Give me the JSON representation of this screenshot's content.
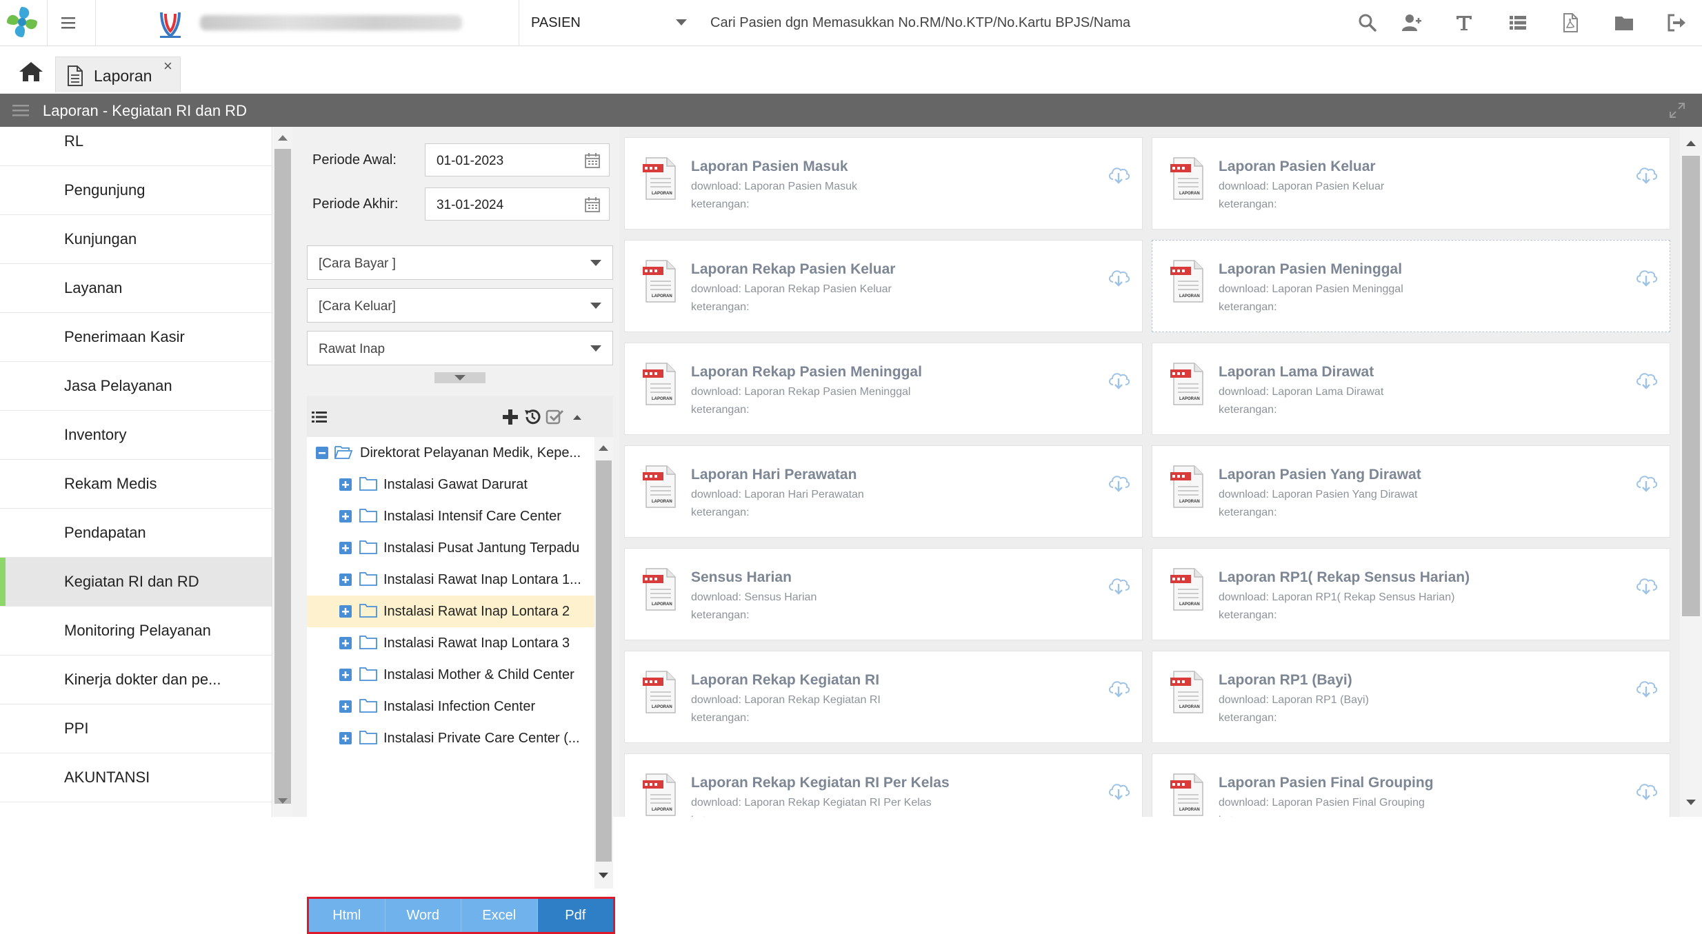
{
  "topbar": {
    "module_select": "PASIEN",
    "search_placeholder": "Cari Pasien dgn Memasukkan No.RM/No.KTP/No.Kartu BPJS/Nama",
    "icons": [
      "search-icon",
      "add-user-icon",
      "text-icon",
      "list-icon",
      "pdf-file-icon",
      "folder-icon",
      "logout-icon"
    ]
  },
  "tabs": [
    {
      "label": "Laporan",
      "close": "×"
    }
  ],
  "titlebar": {
    "title": "Laporan - Kegiatan RI dan RD"
  },
  "sidebar": {
    "items": [
      {
        "label": "RL"
      },
      {
        "label": "Pengunjung"
      },
      {
        "label": "Kunjungan"
      },
      {
        "label": "Layanan"
      },
      {
        "label": "Penerimaan Kasir"
      },
      {
        "label": "Jasa Pelayanan"
      },
      {
        "label": "Inventory"
      },
      {
        "label": "Rekam Medis"
      },
      {
        "label": "Pendapatan"
      },
      {
        "label": "Kegiatan RI dan RD",
        "active": true
      },
      {
        "label": "Monitoring Pelayanan"
      },
      {
        "label": "Kinerja dokter dan pe..."
      },
      {
        "label": "PPI"
      },
      {
        "label": "AKUNTANSI"
      }
    ]
  },
  "filter": {
    "periode_awal_label": "Periode Awal:",
    "periode_awal_value": "01-01-2023",
    "periode_akhir_label": "Periode Akhir:",
    "periode_akhir_value": "31-01-2024",
    "cara_bayar": "[Cara Bayar ]",
    "cara_keluar": "[Cara Keluar]",
    "jenis_rawat": "Rawat Inap",
    "tree": {
      "root": "Direktorat Pelayanan Medik, Kepe...",
      "children": [
        {
          "label": "Instalasi Gawat Darurat"
        },
        {
          "label": "Instalasi Intensif Care Center"
        },
        {
          "label": "Instalasi Pusat Jantung Terpadu"
        },
        {
          "label": "Instalasi Rawat Inap Lontara 1..."
        },
        {
          "label": "Instalasi Rawat Inap Lontara 2",
          "selected": true
        },
        {
          "label": "Instalasi Rawat Inap Lontara 3"
        },
        {
          "label": "Instalasi Mother & Child Center"
        },
        {
          "label": "Instalasi Infection Center"
        },
        {
          "label": "Instalasi Private Care Center (..."
        }
      ]
    },
    "formats": [
      "Html",
      "Word",
      "Excel",
      "Pdf"
    ],
    "selected_format": "Pdf"
  },
  "reports": [
    {
      "title": "Laporan Pasien Masuk",
      "download": "download: Laporan Pasien Masuk",
      "keterangan": "keterangan:"
    },
    {
      "title": "Laporan Pasien Keluar",
      "download": "download: Laporan Pasien Keluar",
      "keterangan": "keterangan:"
    },
    {
      "title": "Laporan Rekap Pasien Keluar",
      "download": "download: Laporan Rekap Pasien Keluar",
      "keterangan": "keterangan:"
    },
    {
      "title": "Laporan Pasien Meninggal",
      "download": "download: Laporan Pasien Meninggal",
      "keterangan": "keterangan:",
      "hovered": true
    },
    {
      "title": "Laporan Rekap Pasien Meninggal",
      "download": "download: Laporan Rekap Pasien Meninggal",
      "keterangan": "keterangan:"
    },
    {
      "title": "Laporan Lama Dirawat",
      "download": "download: Laporan Lama Dirawat",
      "keterangan": "keterangan:"
    },
    {
      "title": "Laporan Hari Perawatan",
      "download": "download: Laporan Hari Perawatan",
      "keterangan": "keterangan:"
    },
    {
      "title": "Laporan Pasien Yang Dirawat",
      "download": "download: Laporan Pasien Yang Dirawat",
      "keterangan": "keterangan:"
    },
    {
      "title": "Sensus Harian",
      "download": "download: Sensus Harian",
      "keterangan": "keterangan:"
    },
    {
      "title": "Laporan RP1( Rekap Sensus Harian)",
      "download": "download: Laporan RP1( Rekap Sensus Harian)",
      "keterangan": "keterangan:"
    },
    {
      "title": "Laporan Rekap Kegiatan RI",
      "download": "download: Laporan Rekap Kegiatan RI",
      "keterangan": "keterangan:"
    },
    {
      "title": "Laporan RP1 (Bayi)",
      "download": "download: Laporan RP1 (Bayi)",
      "keterangan": "keterangan:"
    },
    {
      "title": "Laporan Rekap Kegiatan RI Per Kelas",
      "download": "download: Laporan Rekap Kegiatan RI Per Kelas",
      "keterangan": "keterangan:"
    },
    {
      "title": "Laporan Pasien Final Grouping",
      "download": "download: Laporan Pasien Final Grouping",
      "keterangan": "keterangan:"
    }
  ],
  "colors": {
    "accent_active": "#8cd66a",
    "format_bar": "#6fb2ec",
    "format_selected": "#2f7fc6",
    "highlight_box": "#e0192a",
    "titlebar": "#666666"
  }
}
